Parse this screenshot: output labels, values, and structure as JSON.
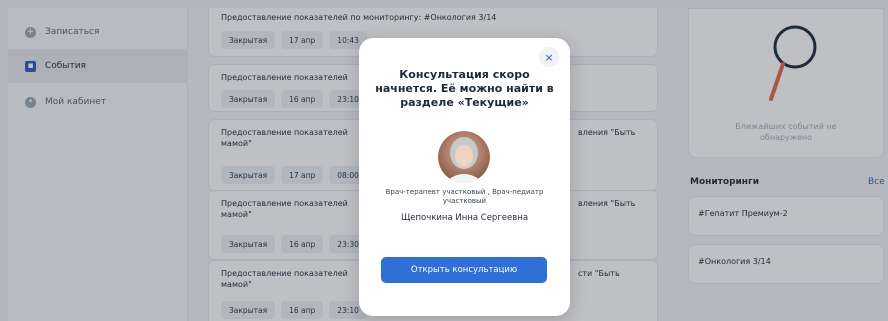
{
  "sidebar": {
    "items": [
      {
        "label": "Записаться",
        "icon": "plus-icon"
      },
      {
        "label": "События",
        "icon": "calendar-icon"
      },
      {
        "label": "Мой кабинет",
        "icon": "gear-icon"
      }
    ]
  },
  "events": [
    {
      "title": "Предоставление показателей по мониторингу: #Онкология 3/14",
      "status": "Закрытая",
      "date": "17 апр",
      "time": "10:43"
    },
    {
      "title": "Предоставление показателей",
      "status": "Закрытая",
      "date": "16 апр",
      "time": "23:10"
    },
    {
      "title": "Предоставление показателей",
      "title_right": "вления \"Быть",
      "title_line2": "мамой\"",
      "status": "Закрытая",
      "date": "17 апр",
      "time": "08:00"
    },
    {
      "title": "Предоставление показателей",
      "title_right": "вления \"Быть",
      "title_line2": "мамой\"",
      "status": "Закрытая",
      "date": "16 апр",
      "time": "23:30"
    },
    {
      "title": "Предоставление показателей",
      "title_right": "сти \"Быть",
      "title_line2": "мамой\"",
      "status": "Закрытая",
      "date": "16 апр",
      "time": "23:10"
    }
  ],
  "right": {
    "empty_text": "Ближайших событий не обнаружено",
    "monitoring_title": "Мониторинги",
    "monitoring_all": "Все",
    "monitorings": [
      "#Гепатит Премиум-2",
      "#Онкология 3/14"
    ]
  },
  "modal": {
    "close": "×",
    "title": "Консультация скоро начнется. Её можно найти в разделе «Текущие»",
    "doctor_spec": "Врач-терапевт участковый , Врач-педиатр участковый",
    "doctor_name": "Щепочкина Инна Сергеевна",
    "button": "Открыть консультацию"
  },
  "colors": {
    "accent": "#2f6fd6",
    "overlay": "rgba(40,48,60,0.30)"
  }
}
